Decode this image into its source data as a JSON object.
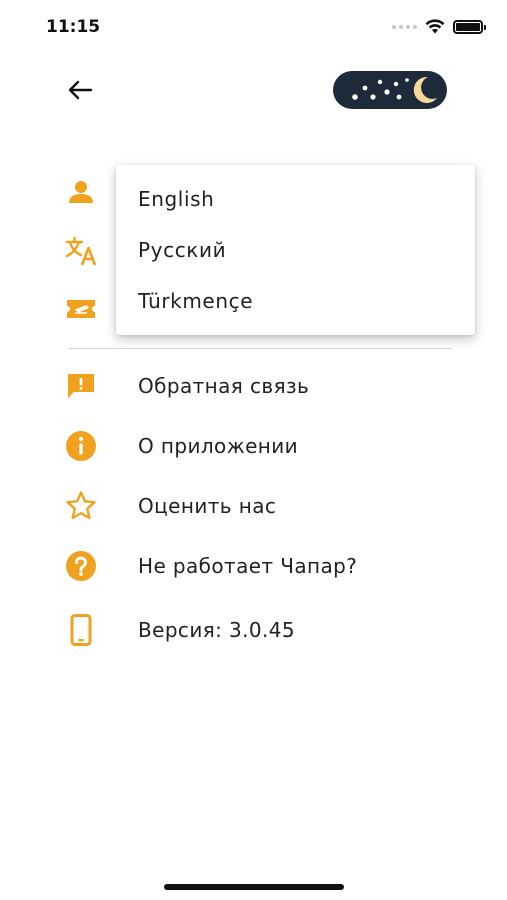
{
  "status_bar": {
    "time": "11:15"
  },
  "header": {
    "back_icon": "arrow-left-icon",
    "theme_toggle_icon": "moon-stars-icon"
  },
  "colors": {
    "accent": "#F0A21F",
    "toggle_bg": "#1D2A3A",
    "moon": "#F5D79A"
  },
  "menu": {
    "hidden_items": [
      {
        "icon": "person-icon"
      },
      {
        "icon": "translate-icon"
      },
      {
        "icon": "ticket-icon"
      }
    ],
    "items": [
      {
        "icon": "feedback-icon",
        "label": "Обратная связь"
      },
      {
        "icon": "info-icon",
        "label": "О приложении"
      },
      {
        "icon": "star-icon",
        "label": "Оценить нас"
      },
      {
        "icon": "help-icon",
        "label": "Не работает Чапар?"
      },
      {
        "icon": "phone-icon",
        "label": "Версия: 3.0.45"
      }
    ]
  },
  "language_dropdown": {
    "options": [
      "English",
      "Русский",
      "Türkmençe"
    ]
  }
}
